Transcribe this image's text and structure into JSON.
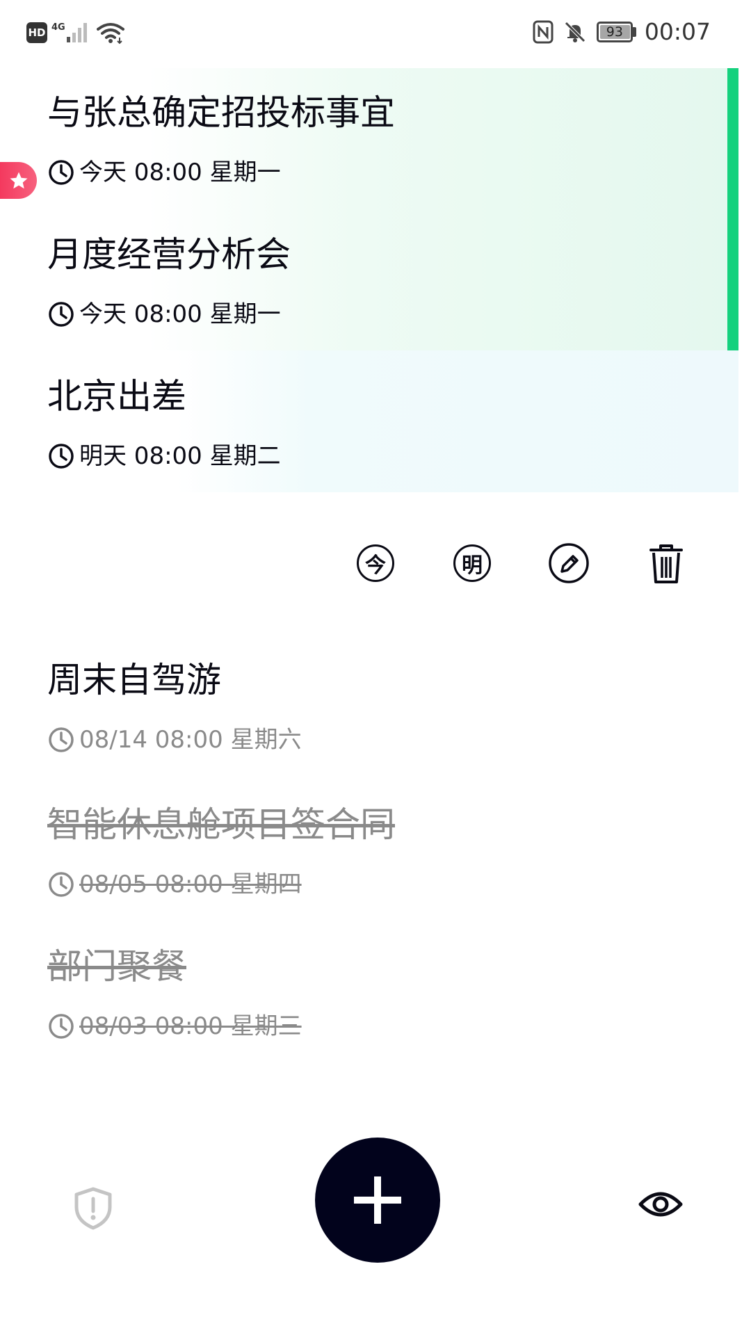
{
  "status_bar": {
    "hd": "HD",
    "network": "4G",
    "battery": "93",
    "time": "00:07"
  },
  "tasks_active": [
    {
      "title": "与张总确定招投标事宜",
      "time": "今天 08:00 星期一"
    },
    {
      "title": "月度经营分析会",
      "time": "今天 08:00 星期一"
    },
    {
      "title": "北京出差",
      "time": "明天 08:00 星期二"
    }
  ],
  "actions": {
    "today_label": "今",
    "tomorrow_label": "明"
  },
  "tasks_other": [
    {
      "title": "周末自驾游",
      "time": "08/14 08:00 星期六"
    },
    {
      "title": "智能休息舱项目签合同",
      "time": "08/05 08:00 星期四"
    },
    {
      "title": "部门聚餐",
      "time": "08/03 08:00 星期三"
    }
  ],
  "colors": {
    "accent_green": "#15d17d",
    "star_red": "#f4395e",
    "fab_dark": "#02031c",
    "dim_text": "#8a8a8a"
  },
  "icons": [
    "star-icon",
    "clock-icon",
    "edit-icon",
    "trash-icon",
    "shield-icon",
    "plus-icon",
    "eye-icon"
  ]
}
